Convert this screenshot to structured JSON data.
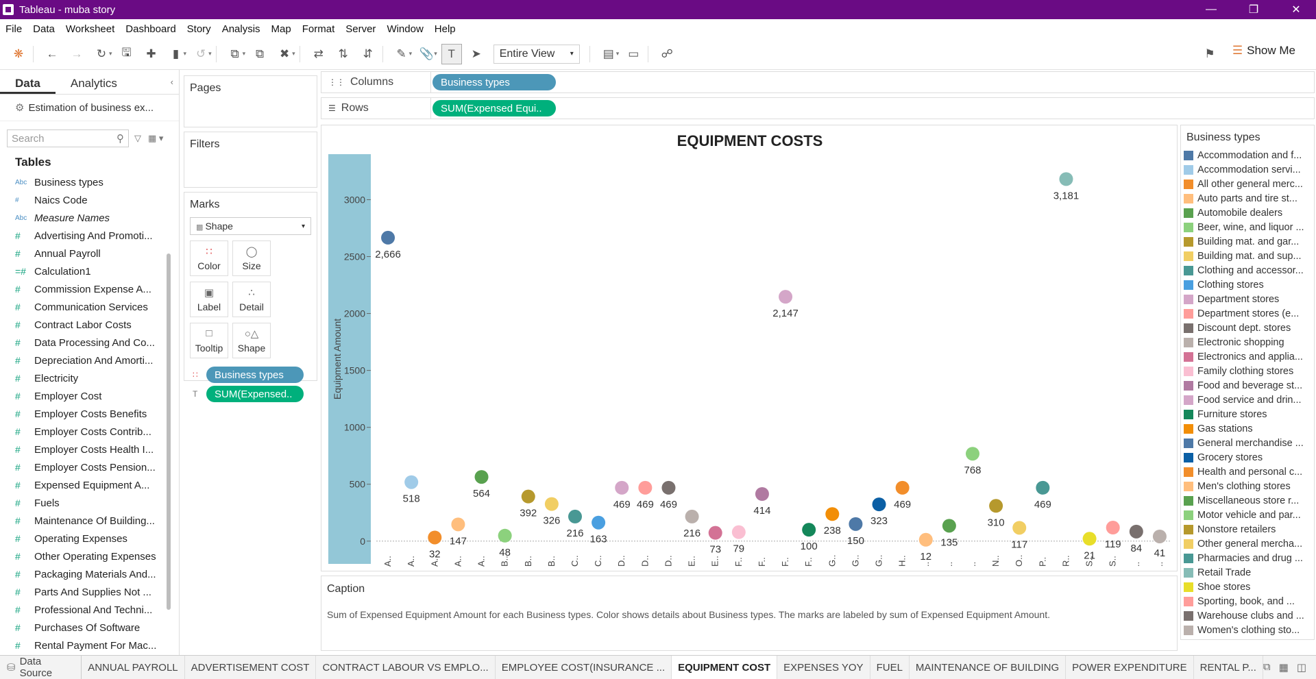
{
  "window": {
    "title": "Tableau - muba story"
  },
  "menu": [
    "File",
    "Data",
    "Worksheet",
    "Dashboard",
    "Story",
    "Analysis",
    "Map",
    "Format",
    "Server",
    "Window",
    "Help"
  ],
  "toolbar": {
    "fit": "Entire View",
    "show_me": "Show Me"
  },
  "left_pane": {
    "tabs": [
      "Data",
      "Analytics"
    ],
    "datasource": "Estimation of business ex...",
    "search_placeholder": "Search",
    "tables_header": "Tables",
    "fields": [
      {
        "name": "Business types",
        "type": "Abc",
        "measure": false,
        "italic": false
      },
      {
        "name": "Naics Code",
        "type": "#",
        "measure": false,
        "italic": false
      },
      {
        "name": "Measure Names",
        "type": "Abc",
        "measure": false,
        "italic": true
      },
      {
        "name": "Advertising And Promoti...",
        "type": "#",
        "measure": true,
        "italic": false
      },
      {
        "name": "Annual Payroll",
        "type": "#",
        "measure": true,
        "italic": false
      },
      {
        "name": "Calculation1",
        "type": "=#",
        "measure": true,
        "italic": false
      },
      {
        "name": "Commission Expense A...",
        "type": "#",
        "measure": true,
        "italic": false
      },
      {
        "name": "Communication Services",
        "type": "#",
        "measure": true,
        "italic": false
      },
      {
        "name": "Contract Labor Costs",
        "type": "#",
        "measure": true,
        "italic": false
      },
      {
        "name": "Data Processing And Co...",
        "type": "#",
        "measure": true,
        "italic": false
      },
      {
        "name": "Depreciation And Amorti...",
        "type": "#",
        "measure": true,
        "italic": false
      },
      {
        "name": "Electricity",
        "type": "#",
        "measure": true,
        "italic": false
      },
      {
        "name": "Employer Cost",
        "type": "#",
        "measure": true,
        "italic": false
      },
      {
        "name": "Employer Costs Benefits",
        "type": "#",
        "measure": true,
        "italic": false
      },
      {
        "name": "Employer Costs Contrib...",
        "type": "#",
        "measure": true,
        "italic": false
      },
      {
        "name": "Employer Costs Health I...",
        "type": "#",
        "measure": true,
        "italic": false
      },
      {
        "name": "Employer Costs Pension...",
        "type": "#",
        "measure": true,
        "italic": false
      },
      {
        "name": "Expensed Equipment A...",
        "type": "#",
        "measure": true,
        "italic": false
      },
      {
        "name": "Fuels",
        "type": "#",
        "measure": true,
        "italic": false
      },
      {
        "name": "Maintenance Of Building...",
        "type": "#",
        "measure": true,
        "italic": false
      },
      {
        "name": "Operating Expenses",
        "type": "#",
        "measure": true,
        "italic": false
      },
      {
        "name": "Other Operating Expenses",
        "type": "#",
        "measure": true,
        "italic": false
      },
      {
        "name": "Packaging Materials And...",
        "type": "#",
        "measure": true,
        "italic": false
      },
      {
        "name": "Parts And Supplies Not ...",
        "type": "#",
        "measure": true,
        "italic": false
      },
      {
        "name": "Professional And Techni...",
        "type": "#",
        "measure": true,
        "italic": false
      },
      {
        "name": "Purchases Of Software",
        "type": "#",
        "measure": true,
        "italic": false
      },
      {
        "name": "Rental Payment For Mac...",
        "type": "#",
        "measure": true,
        "italic": false
      }
    ]
  },
  "cards": {
    "pages": "Pages",
    "filters": "Filters",
    "marks": "Marks",
    "mark_type": "Shape",
    "mark_buttons": [
      "Color",
      "Size",
      "Label",
      "Detail",
      "Tooltip",
      "Shape"
    ],
    "mark_pills": [
      "Business types",
      "SUM(Expensed.."
    ]
  },
  "shelves": {
    "columns_label": "Columns",
    "columns_pill": "Business types",
    "rows_label": "Rows",
    "rows_pill": "SUM(Expensed Equi.."
  },
  "chart_data": {
    "type": "scatter",
    "title": "EQUIPMENT COSTS",
    "ylabel": "Equipment Amount",
    "ylim": [
      -200,
      3400
    ],
    "yticks": [
      0,
      500,
      1000,
      1500,
      2000,
      2500,
      3000
    ],
    "grid": false,
    "x_tick_labels": [
      "A..",
      "A..",
      "A..",
      "A..",
      "A..",
      "B..",
      "B..",
      "B..",
      "C..",
      "C..",
      "D..",
      "D..",
      "D..",
      "E..",
      "E..",
      "F..",
      "F..",
      "F..",
      "F..",
      "G..",
      "G..",
      "G..",
      "H..",
      "..",
      "..",
      "..",
      "N..",
      "O..",
      "P..",
      "R..",
      "S..",
      "S..",
      "..",
      ".."
    ],
    "categories": [
      "Accommodation and f...",
      "Accommodation servi...",
      "All other general merc...",
      "Auto parts and tire st...",
      "Automobile dealers",
      "Beer, wine, and liquor ...",
      "Building mat. and gar...",
      "Building mat. and sup...",
      "Clothing and accessor...",
      "Clothing stores",
      "Department stores",
      "Department stores (e...",
      "Discount dept. stores",
      "Electronic shopping",
      "Electronics and applia...",
      "Family clothing stores",
      "Food and beverage st...",
      "Food service and drin...",
      "Furniture stores",
      "Gas stations",
      "General merchandise ...",
      "Grocery stores",
      "Health and personal c...",
      "Men's clothing stores",
      "Miscellaneous store r...",
      "Motor vehicle and par...",
      "Nonstore retailers",
      "Other general mercha...",
      "Pharmacies and drug ...",
      "Retail Trade",
      "Shoe stores",
      "Sporting, book, and ...",
      "Warehouse clubs and ...",
      "Women's clothing sto..."
    ],
    "values": [
      2666,
      518,
      32,
      147,
      564,
      48,
      392,
      326,
      216,
      163,
      469,
      469,
      469,
      216,
      73,
      79,
      414,
      2147,
      100,
      238,
      150,
      323,
      469,
      12,
      135,
      768,
      310,
      117,
      469,
      3181,
      21,
      119,
      84,
      41
    ],
    "labels": [
      "2,666",
      "518",
      "32",
      "147",
      "564",
      "48",
      "392",
      "326",
      "216",
      "163",
      "469",
      "469",
      "469",
      "216",
      "73",
      "79",
      "414",
      "2,147",
      "100",
      "238",
      "150",
      "323",
      "469",
      "12",
      "135",
      "768",
      "310",
      "117",
      "469",
      "3,181",
      "21",
      "119",
      "84",
      "41"
    ],
    "colors": [
      "#4e79a7",
      "#a0cbe8",
      "#f28e2b",
      "#ffbe7d",
      "#59a14f",
      "#8cd17d",
      "#b6992d",
      "#f1ce63",
      "#499894",
      "#4a9fe0",
      "#d4a6c8",
      "#ff9d9a",
      "#79706e",
      "#bab0ac",
      "#d37295",
      "#fabfd2",
      "#b07aa1",
      "#d4a6c8",
      "#14875a",
      "#f28e07",
      "#4e79a7",
      "#0b5fa5",
      "#f28e2b",
      "#ffbe7d",
      "#59a14f",
      "#8cd17d",
      "#b6992d",
      "#f1ce63",
      "#499894",
      "#86bcb6",
      "#e8de2a",
      "#ff9d9a",
      "#79706e",
      "#bab0ac"
    ],
    "legend_title": "Business types",
    "legend_placement": "right"
  },
  "caption": {
    "header": "Caption",
    "text": "Sum of Expensed Equipment Amount for each Business types.  Color shows details about Business types.  The marks are labeled by sum of Expensed Equipment Amount."
  },
  "legend_items": [
    "Accommodation and f...",
    "Accommodation servi...",
    "All other general merc...",
    "Auto parts and tire st...",
    "Automobile dealers",
    "Beer, wine, and liquor ...",
    "Building mat. and gar...",
    "Building mat. and sup...",
    "Clothing and accessor...",
    "Clothing stores",
    "Department stores",
    "Department stores (e...",
    "Discount dept. stores",
    "Electronic shopping",
    "Electronics and applia...",
    "Family clothing stores",
    "Food and beverage st...",
    "Food service and drin...",
    "Furniture stores",
    "Gas stations",
    "General merchandise ...",
    "Grocery stores",
    "Health and personal c...",
    "Men's clothing stores",
    "Miscellaneous store r...",
    "Motor vehicle and par...",
    "Nonstore retailers",
    "Other general mercha...",
    "Pharmacies and drug ...",
    "Retail Trade",
    "Shoe stores",
    "Sporting, book, and ...",
    "Warehouse clubs and ...",
    "Women's clothing sto..."
  ],
  "sheet_tabs": {
    "datasource": "Data Source",
    "tabs": [
      "ANNUAL PAYROLL",
      "ADVERTISEMENT COST",
      "CONTRACT LABOUR VS EMPLO...",
      "EMPLOYEE COST(INSURANCE ...",
      "EQUIPMENT COST",
      "EXPENSES YOY",
      "FUEL",
      "MAINTENANCE OF BUILDING",
      "POWER EXPENDITURE",
      "RENTAL P..."
    ],
    "active": "EQUIPMENT COST"
  }
}
